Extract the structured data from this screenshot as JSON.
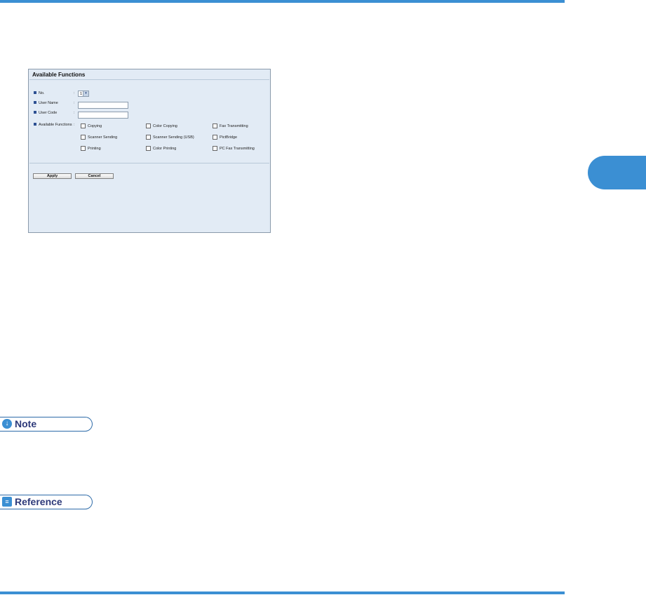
{
  "panel": {
    "title": "Available Functions",
    "fields": {
      "no_label": "No.",
      "no_value": "1",
      "user_name_label": "User Name",
      "user_name_value": "",
      "user_code_label": "User Code",
      "user_code_value": "",
      "available_functions_label": "Available Functions",
      "colon": ":"
    },
    "functions": [
      "Copying",
      "Color Copying",
      "Fax Transmitting",
      "Scanner Sending",
      "Scanner Sending (USB)",
      "PictBridge",
      "Printing",
      "Color Printing",
      "PC Fax Transmitting"
    ],
    "apply_label": "Apply",
    "cancel_label": "Cancel"
  },
  "note_label": "Note",
  "reference_label": "Reference",
  "colors": {
    "accent": "#3b8fd3",
    "bullet": "#2c4f92",
    "panel_bg": "#e2ebf5"
  }
}
